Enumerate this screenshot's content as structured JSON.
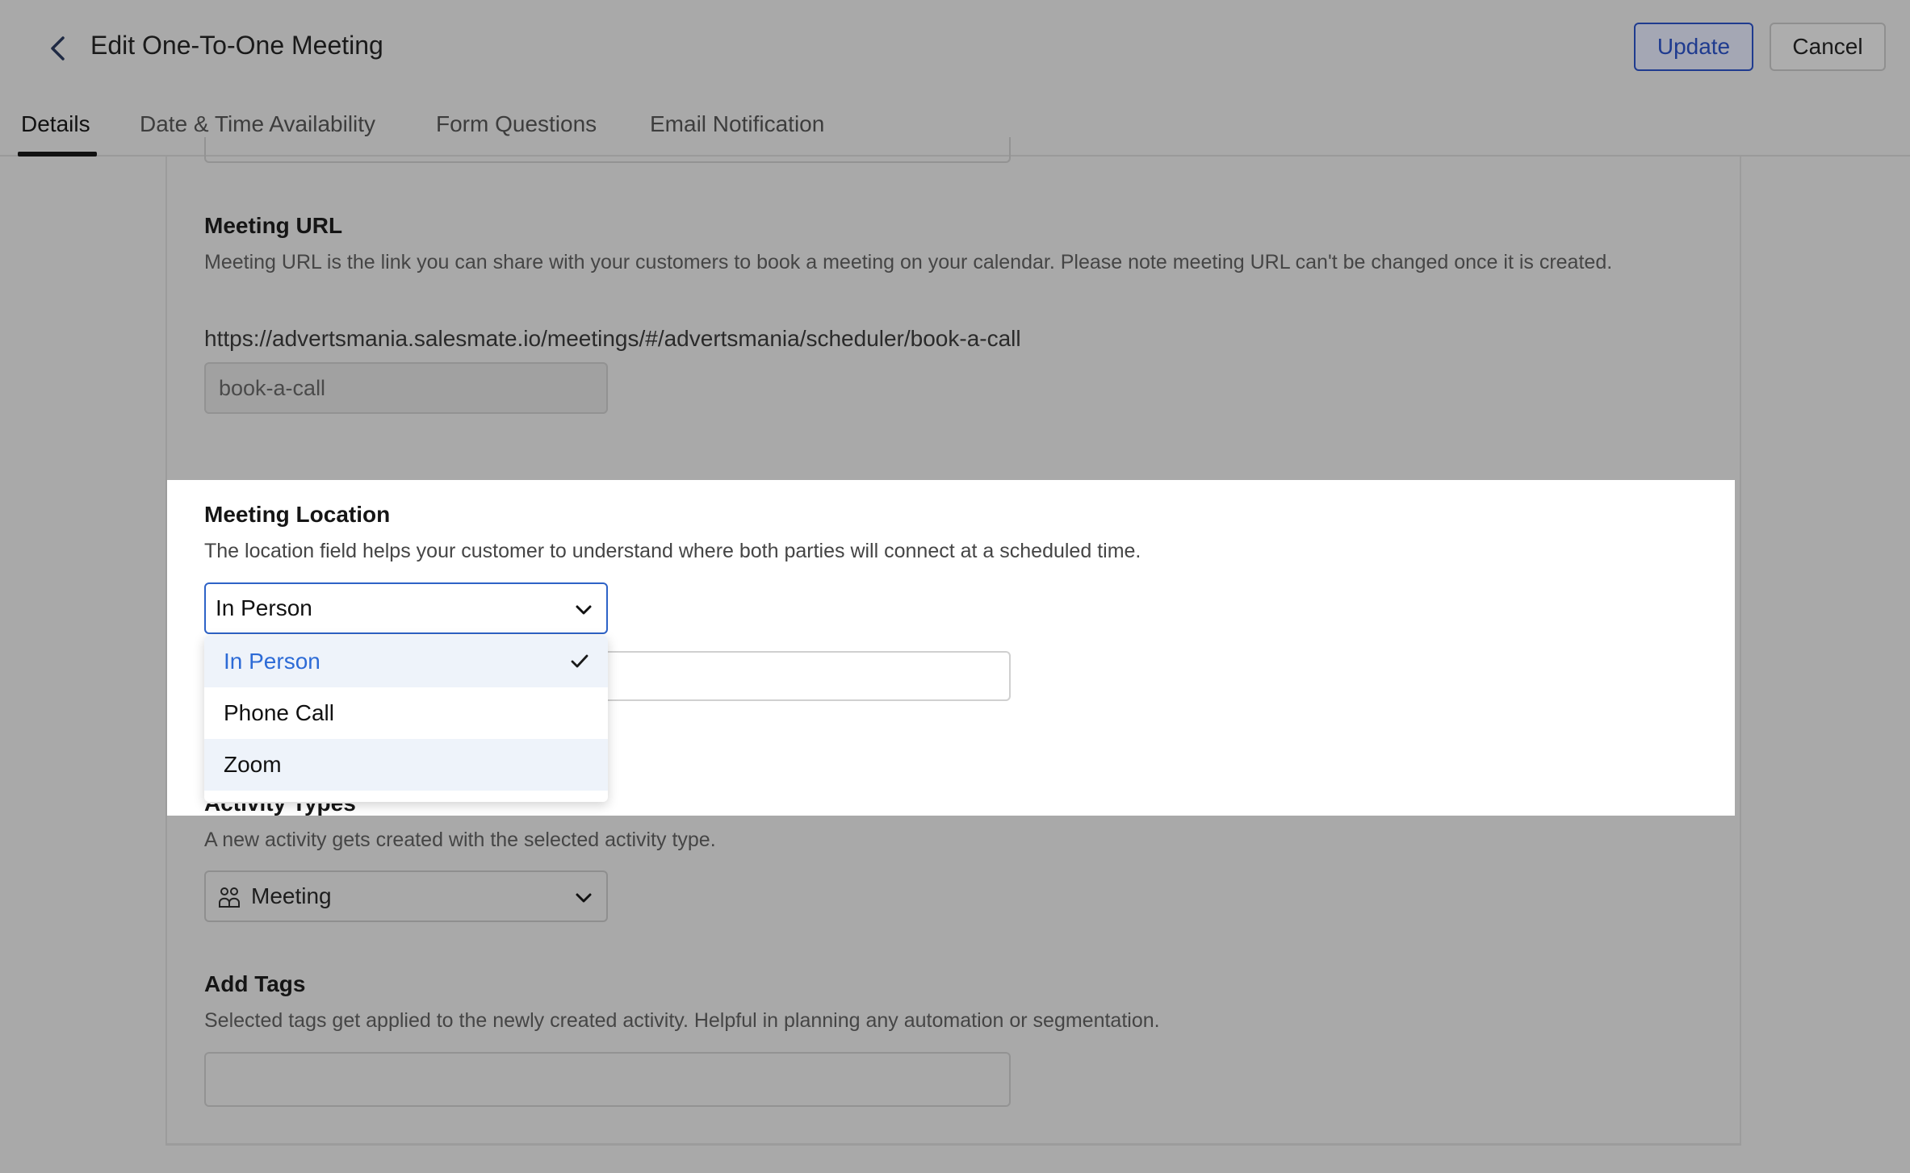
{
  "header": {
    "title": "Edit One-To-One Meeting",
    "update_label": "Update",
    "cancel_label": "Cancel"
  },
  "tabs": [
    {
      "label": "Details",
      "active": true
    },
    {
      "label": "Date & Time Availability",
      "active": false
    },
    {
      "label": "Form Questions",
      "active": false
    },
    {
      "label": "Email Notification",
      "active": false
    }
  ],
  "meeting_url": {
    "title": "Meeting URL",
    "description": "Meeting URL is the link you can share with your customers to book a meeting on your calendar. Please note meeting URL can't be changed once it is created.",
    "full_url": "https://advertsmania.salesmate.io/meetings/#/advertsmania/scheduler/book-a-call",
    "slug_value": "book-a-call"
  },
  "meeting_location": {
    "title": "Meeting Location",
    "description": "The location field helps your customer to understand where both parties will connect at a scheduled time.",
    "selected": "In Person",
    "options": [
      "In Person",
      "Phone Call",
      "Zoom"
    ]
  },
  "activity_types": {
    "title": "Activity Types",
    "description": "A new activity gets created with the selected activity type.",
    "selected": "Meeting",
    "icon": "people-icon"
  },
  "add_tags": {
    "title": "Add Tags",
    "description": "Selected tags get applied to the newly created activity. Helpful in planning any automation or segmentation."
  },
  "colors": {
    "accent": "#2d6bd6",
    "overlay": "#a9a9a9"
  }
}
